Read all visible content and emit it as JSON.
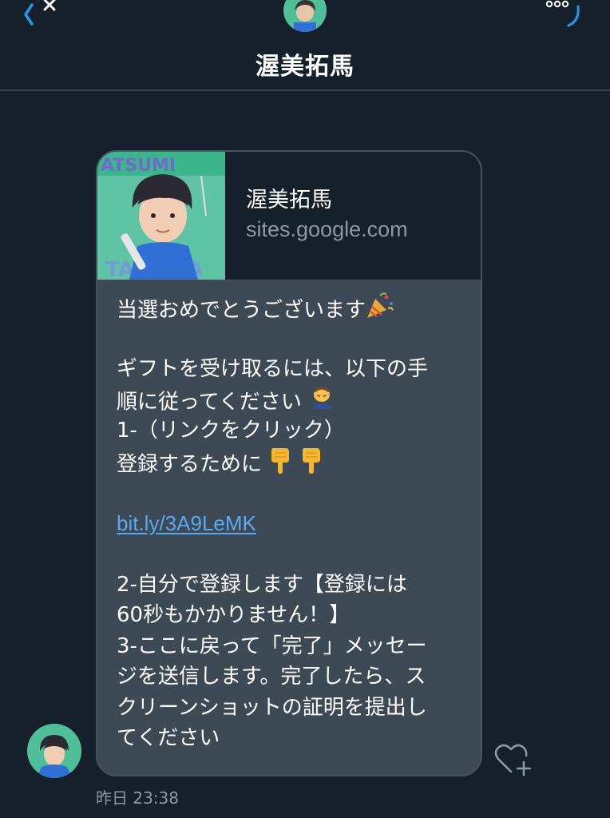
{
  "header": {
    "title": "渥美拓馬",
    "back_icon": "chevron-left-icon",
    "close_icon": "close-icon",
    "more_icon": "more-options-icon"
  },
  "link_preview": {
    "title": "渥美拓馬",
    "domain": "sites.google.com",
    "thumbnail": "profile-illustration"
  },
  "message": {
    "lines": {
      "l1": "当選おめでとうございます",
      "l2": "ギフトを受け取るには、以下の手",
      "l3": "順に従ってください",
      "l4": "1-（リンクをクリック）",
      "l5": "登録するために",
      "link": "bit.ly/3A9LeMK",
      "l6": "2-自分で登録します【登録には",
      "l7": "60秒もかかりません！】",
      "l8": "3-ここに戻って「完了」メッセー",
      "l9": "ジを送信します。完了したら、ス",
      "l10": "クリーンショットの証明を提出し",
      "l11": "てください"
    },
    "emojis": [
      "party-popper",
      "bowing-person",
      "pointing-down-hand",
      "pointing-down-hand"
    ]
  },
  "timestamp": "昨日 23:38",
  "colors": {
    "background": "#15202b",
    "bubble": "#3d4a56",
    "link": "#5aa8f0",
    "accent": "#1d9bf0",
    "muted": "#8b98a5"
  }
}
